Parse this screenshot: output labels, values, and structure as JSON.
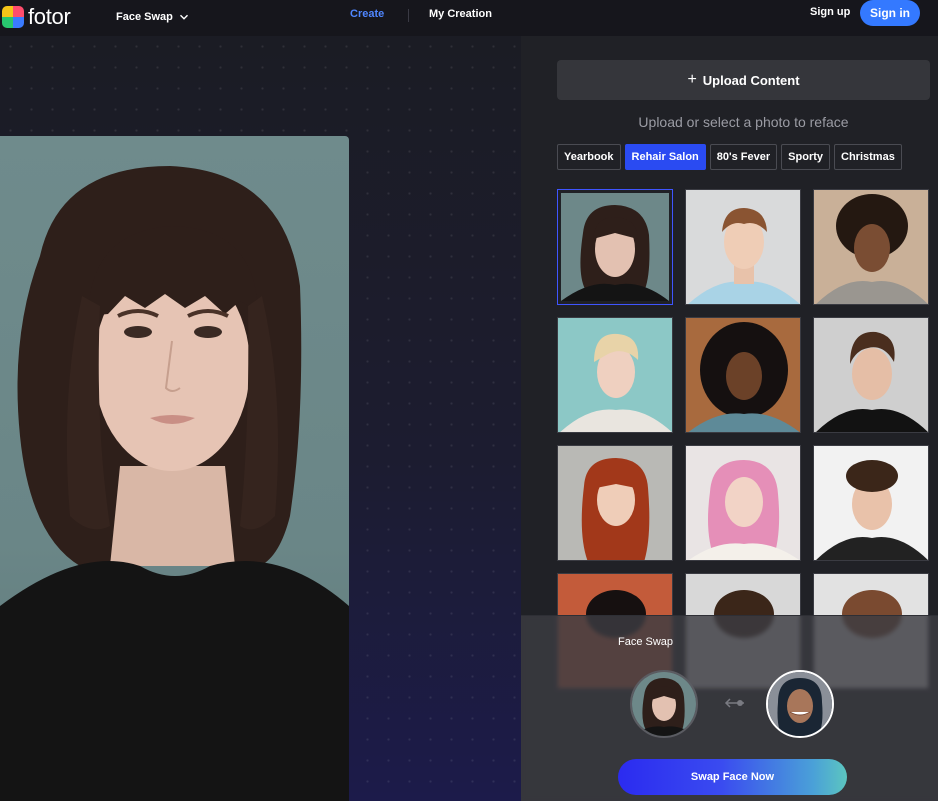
{
  "header": {
    "logo_text": "fotor",
    "tool_menu_label": "Face Swap",
    "nav_create": "Create",
    "nav_my_creation": "My Creation",
    "sign_up": "Sign up",
    "sign_in": "Sign in"
  },
  "panel": {
    "upload_label": "Upload Content",
    "hint": "Upload or select a photo to reface",
    "tabs": [
      {
        "label": "Yearbook",
        "active": false
      },
      {
        "label": "Rehair Salon",
        "active": true
      },
      {
        "label": "80's Fever",
        "active": false
      },
      {
        "label": "Sporty",
        "active": false
      },
      {
        "label": "Christmas",
        "active": false
      }
    ],
    "templates_count_visible": 12,
    "selected_template_index": 0
  },
  "swap": {
    "title": "Face Swap",
    "button_label": "Swap Face Now"
  },
  "colors": {
    "accent": "#3479ff",
    "active_tab": "#2a4bf2",
    "panel_bg": "#202126"
  }
}
